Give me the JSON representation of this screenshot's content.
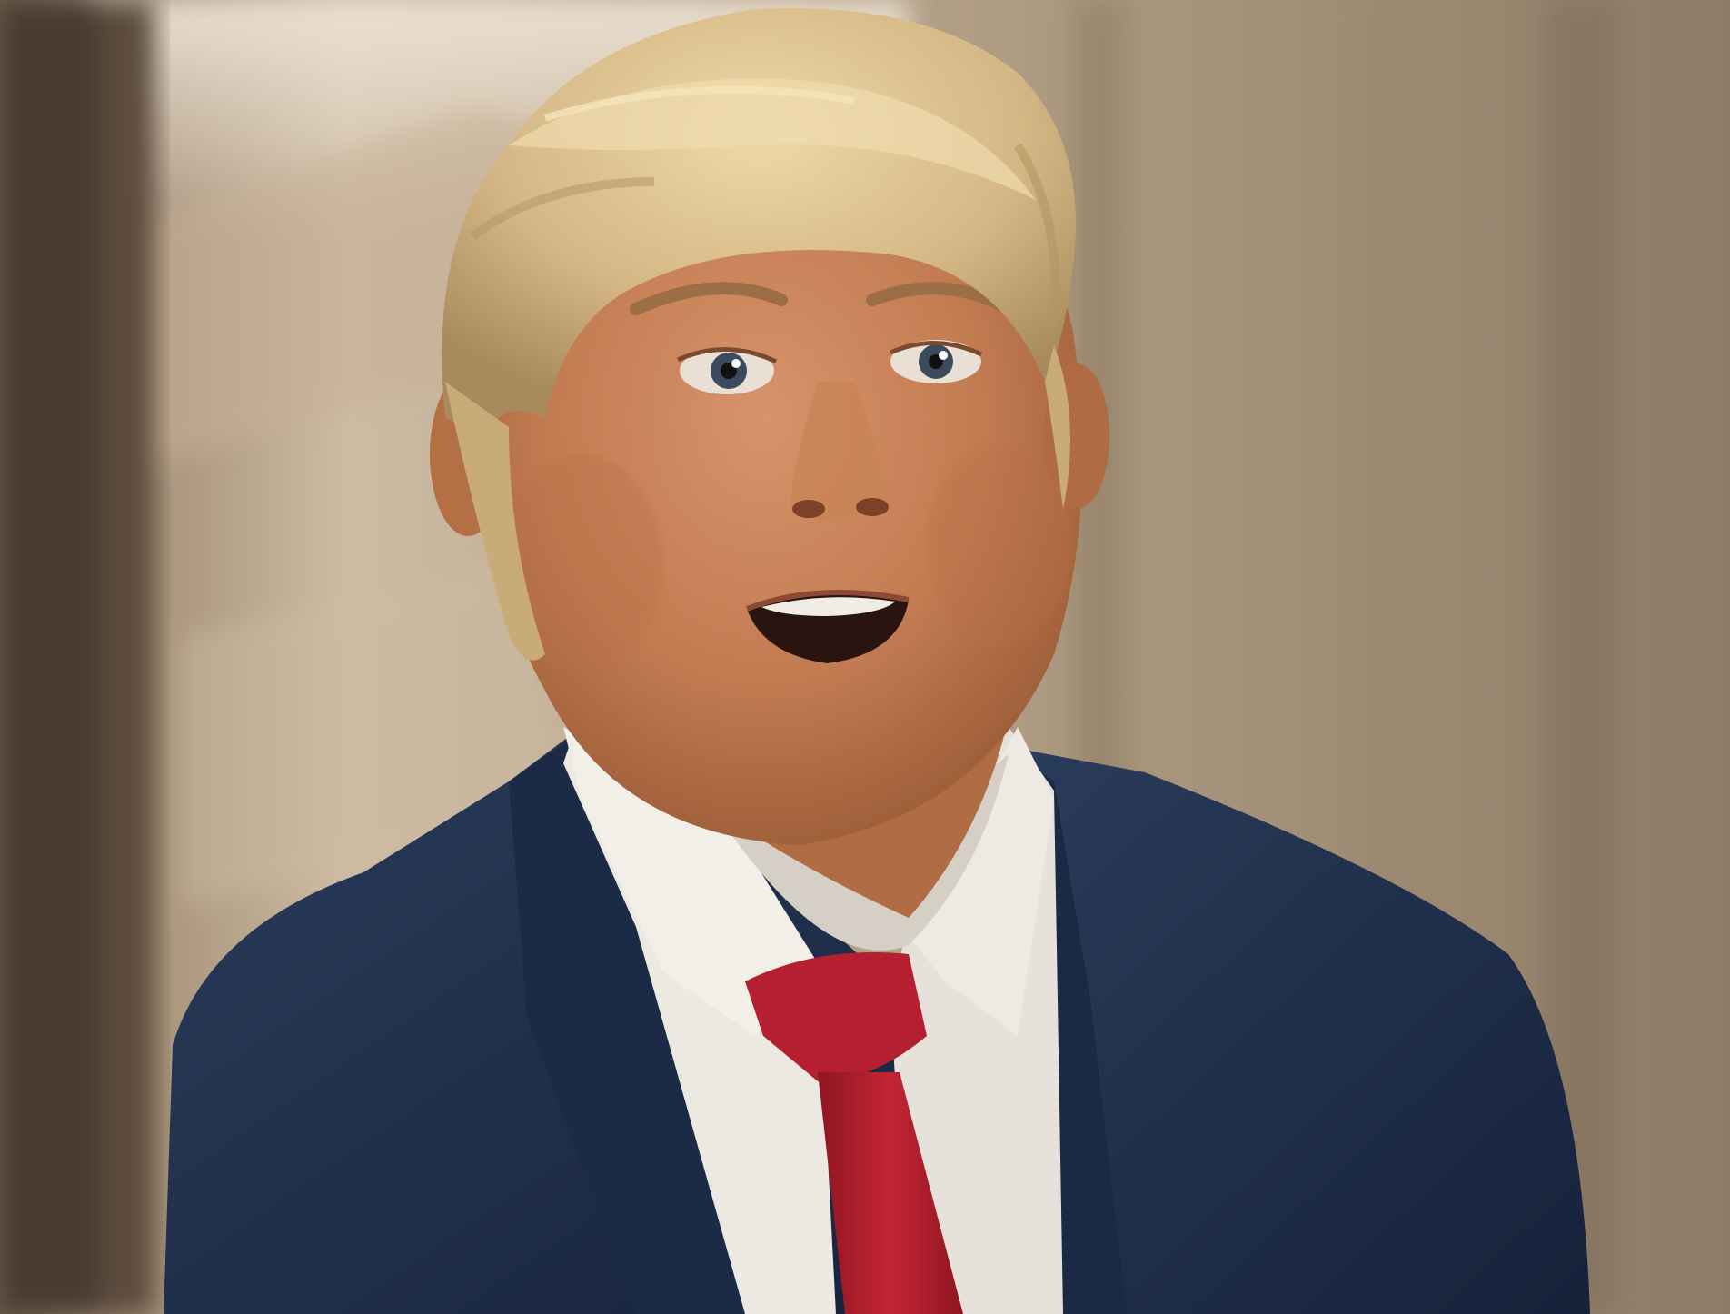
{
  "scene": {
    "colors": {
      "wall_light": "#d9cbb6",
      "wall_mid": "#a8957c",
      "wall_dark": "#7a6a55",
      "door_frame": "#5a4a3c",
      "hair": "#d8bd8c",
      "hair_shadow": "#b89a68",
      "skin": "#c9855a",
      "skin_shadow": "#a9683f",
      "suit": "#22334f",
      "suit_shadow": "#172338",
      "shirt": "#ece8e2",
      "shirt_shadow": "#cfc8bf",
      "tie": "#b21f2d",
      "tie_shadow": "#861522",
      "eye": "#3b4a5c",
      "mouth": "#2a1410",
      "teeth": "#f1ece4"
    }
  }
}
